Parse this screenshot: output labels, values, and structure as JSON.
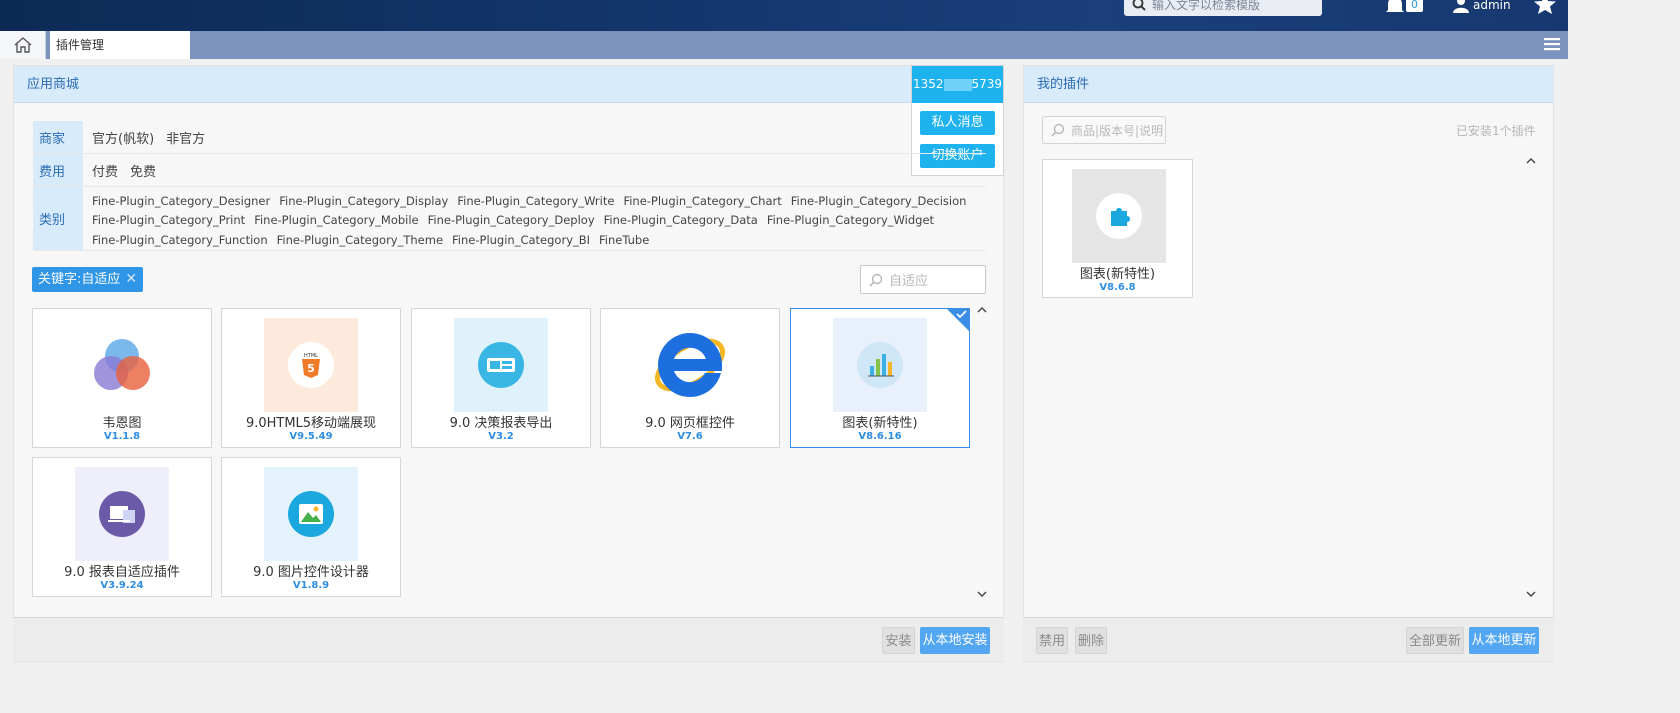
{
  "header": {
    "search_placeholder": "输入文字以检索模版",
    "notification_count": "0",
    "user_name": "admin"
  },
  "tabs": {
    "current": "插件管理"
  },
  "store": {
    "title": "应用商城",
    "account": {
      "number_prefix": "1352",
      "number_suffix": "5739",
      "private_message": "私人消息",
      "switch_account": "切换账户"
    },
    "filters": {
      "merchant": {
        "label": "商家",
        "options": [
          "官方(帆软)",
          "非官方"
        ]
      },
      "fee": {
        "label": "费用",
        "options": [
          "付费",
          "免费"
        ]
      },
      "category": {
        "label": "类别",
        "options": [
          "Fine-Plugin_Category_Designer",
          "Fine-Plugin_Category_Display",
          "Fine-Plugin_Category_Write",
          "Fine-Plugin_Category_Chart",
          "Fine-Plugin_Category_Decision",
          "Fine-Plugin_Category_Print",
          "Fine-Plugin_Category_Mobile",
          "Fine-Plugin_Category_Deploy",
          "Fine-Plugin_Category_Data",
          "Fine-Plugin_Category_Widget",
          "Fine-Plugin_Category_Function",
          "Fine-Plugin_Category_Theme",
          "Fine-Plugin_Category_BI",
          "FineTube"
        ]
      }
    },
    "keyword_tag": "关键字:自适应",
    "keyword_close": "✕",
    "keyword_search_value": "自适应",
    "plugins": [
      {
        "name": "韦恩图",
        "version": "V1.1.8",
        "icon": "venn-diagram-icon"
      },
      {
        "name": "9.0HTML5移动端展现",
        "version": "V9.5.49",
        "icon": "html5-icon"
      },
      {
        "name": "9.0 决策报表导出",
        "version": "V3.2",
        "icon": "report-export-icon"
      },
      {
        "name": "9.0 网页框控件",
        "version": "V7.6",
        "icon": "internet-explorer-icon"
      },
      {
        "name": "图表(新特性)",
        "version": "V8.6.16",
        "icon": "bar-chart-icon",
        "selected": true
      },
      {
        "name": "9.0 报表自适应插件",
        "version": "V3.9.24",
        "icon": "responsive-devices-icon"
      },
      {
        "name": "9.0 图片控件设计器",
        "version": "V1.8.9",
        "icon": "image-icon"
      }
    ],
    "footer": {
      "install": "安装",
      "install_local": "从本地安装"
    }
  },
  "my_plugins": {
    "title": "我的插件",
    "search_placeholder": "商品|版本号|说明",
    "installed_count": "已安装1个插件",
    "plugins": [
      {
        "name": "图表(新特性)",
        "version": "V8.6.8",
        "icon": "puzzle-icon"
      }
    ],
    "footer": {
      "disable": "禁用",
      "delete": "删除",
      "update_all": "全部更新",
      "update_local": "从本地更新"
    }
  },
  "colors": {
    "header_bg": "#12356a",
    "accent_blue": "#1eb3ee",
    "link_blue": "#2f8ee2",
    "panel_head_bg": "#d8ebfb"
  }
}
